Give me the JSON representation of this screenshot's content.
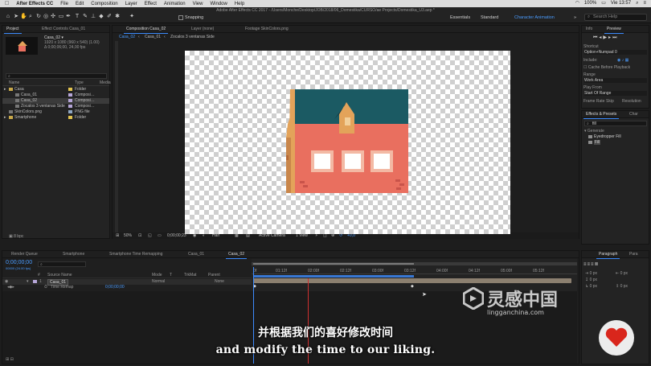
{
  "menubar": {
    "apple": "",
    "app": "After Effects CC",
    "items": [
      "File",
      "Edit",
      "Composition",
      "Layer",
      "Effect",
      "Animation",
      "View",
      "Window",
      "Help"
    ],
    "clock": "Vie 13:57",
    "battery": "100%"
  },
  "toolbar": {
    "window_title": "Adobe After Effects CC 2017 - /Users/Monche/Desktop/JOB/2018/06_Domestika/CURSO/ae Projects/Domestika_U3.aep *",
    "snapping": "Snapping",
    "workspaces": [
      "Essentials",
      "Standard",
      "Character Animation"
    ],
    "search_placeholder": "Search Help"
  },
  "project_panel": {
    "tabs": [
      "Project",
      "Effect Controls Casa_01"
    ],
    "item_name": "Casa_02 ▾",
    "item_info": [
      "1920 x 1080 (960 x 540) (1.00)",
      "Δ 0;00;06;00, 24,00 fps"
    ],
    "columns": [
      "Name",
      "Type",
      "Media"
    ],
    "items": [
      {
        "name": "Casa",
        "type": "Folder",
        "color": "#e3c44f",
        "indent": 0,
        "selected": false
      },
      {
        "name": "Casa_01",
        "type": "Composi…",
        "color": "#b6a6d8",
        "indent": 1,
        "selected": false
      },
      {
        "name": "Casa_02",
        "type": "Composi…",
        "color": "#b6a6d8",
        "indent": 1,
        "selected": true
      },
      {
        "name": "Zocalos 3 ventanas Side",
        "type": "Composi…",
        "color": "#b6a6d8",
        "indent": 1,
        "selected": false
      },
      {
        "name": "SkinColors.png",
        "type": "PNG file",
        "color": "#8fa7c4",
        "indent": 0,
        "selected": false
      },
      {
        "name": "Smartphone",
        "type": "Folder",
        "color": "#e3c44f",
        "indent": 0,
        "selected": false
      }
    ],
    "footer": "8 bpc"
  },
  "viewer": {
    "tabs": [
      "Composition Casa_02",
      "Layer (none)",
      "Footage SkinColors.png"
    ],
    "breadcrumbs": [
      "Casa_02",
      "Casa_01",
      "Zocalos 3 ventanas Side"
    ],
    "zoom": "50%",
    "timecode": "0;00;00;23",
    "resolution": "Half",
    "camera": "Active Camera",
    "views": "1 View",
    "exposure": "+0,0"
  },
  "right_panel": {
    "tabs": [
      "Info",
      "Preview"
    ],
    "shortcut_label": "Shortcut",
    "shortcut": "Option+Numpad 0",
    "include_label": "Include:",
    "cache_label": "Cache Before Playback",
    "range_label": "Range",
    "range": "Work Area",
    "play_from_label": "Play From",
    "play_from": "Start Of Range",
    "frame_rate_label": "Frame Rate",
    "skip_label": "Skip",
    "resolution_label": "Resolution",
    "effects_tabs": [
      "Effects & Presets",
      "Char"
    ],
    "effects_search": "fill",
    "effects_group": "▾ Generate",
    "effects_items": [
      "Eyedropper Fill",
      "Fill"
    ],
    "paragraph_tabs": [
      "Paragraph",
      "Para"
    ],
    "px_values": [
      "0 px",
      "0 px",
      "0 px",
      "0 px",
      "0 px"
    ]
  },
  "timeline": {
    "tabs": [
      "Render Queue",
      "Smartphone",
      "Smartphone Time Remapping",
      "Casa_01",
      "Casa_02"
    ],
    "timecode": "0;00;00;00",
    "fps_info": "00000 (24.00 fps)",
    "columns": [
      "#",
      "Source Name",
      "Mode",
      "T",
      "TrkMat",
      "Parent"
    ],
    "layer_num": "1",
    "layer_name": "Casa_01",
    "layer_mode": "Normal",
    "layer_parent": "None",
    "sub_property": "Time Remap",
    "sub_value": "0;00;00;00",
    "ruler": [
      "01:12f",
      "02:00f",
      "02:12f",
      "03:00f",
      "03:12f",
      "04:00f",
      "04:12f",
      "05:00f",
      "05:12f"
    ],
    "ruler_start": "0f"
  },
  "subtitles": {
    "zh": "并根据我们的喜好修改时间",
    "en": "and modify the time to our liking."
  },
  "watermark": {
    "cn": "灵感中国",
    "url": "lingganchina.com"
  },
  "colors": {
    "accent": "#3d8cff",
    "roof": "#1b5a63",
    "wall": "#e96f5f",
    "gable": "#e3a35a",
    "work_area": "#3d8cff"
  }
}
